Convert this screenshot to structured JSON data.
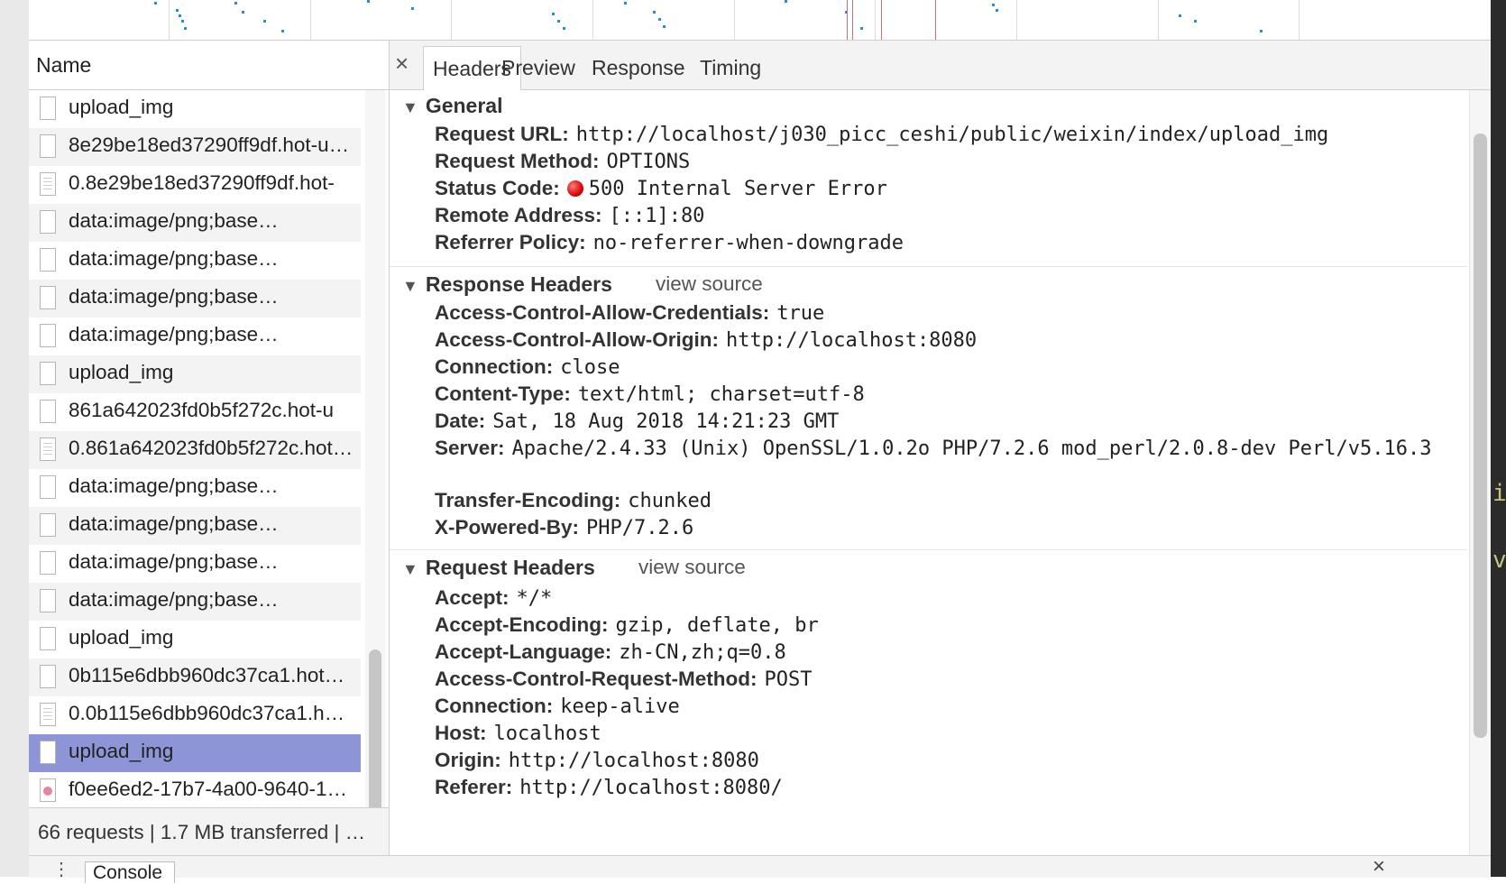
{
  "name_column": {
    "header": "Name",
    "rows": [
      {
        "name": "upload_img",
        "icon": "blank-file-icon",
        "selected": false
      },
      {
        "name": "8e29be18ed37290ff9df.hot-u…",
        "icon": "blank-file-icon",
        "selected": false
      },
      {
        "name": "0.8e29be18ed37290ff9df.hot-",
        "icon": "script-file-icon",
        "selected": false
      },
      {
        "name": "data:image/png;base…",
        "icon": "blank-file-icon",
        "selected": false
      },
      {
        "name": "data:image/png;base…",
        "icon": "blank-file-icon",
        "selected": false
      },
      {
        "name": "data:image/png;base…",
        "icon": "blank-file-icon",
        "selected": false
      },
      {
        "name": "data:image/png;base…",
        "icon": "blank-file-icon",
        "selected": false
      },
      {
        "name": "upload_img",
        "icon": "blank-file-icon",
        "selected": false
      },
      {
        "name": "861a642023fd0b5f272c.hot-u",
        "icon": "blank-file-icon",
        "selected": false
      },
      {
        "name": "0.861a642023fd0b5f272c.hot…",
        "icon": "script-file-icon",
        "selected": false
      },
      {
        "name": "data:image/png;base…",
        "icon": "blank-file-icon",
        "selected": false
      },
      {
        "name": "data:image/png;base…",
        "icon": "blank-file-icon",
        "selected": false
      },
      {
        "name": "data:image/png;base…",
        "icon": "blank-file-icon",
        "selected": false
      },
      {
        "name": "data:image/png;base…",
        "icon": "blank-file-icon",
        "selected": false
      },
      {
        "name": "upload_img",
        "icon": "blank-file-icon",
        "selected": false
      },
      {
        "name": "0b115e6dbb960dc37ca1.hot…",
        "icon": "blank-file-icon",
        "selected": false
      },
      {
        "name": "0.0b115e6dbb960dc37ca1.h…",
        "icon": "script-file-icon",
        "selected": false
      },
      {
        "name": "upload_img",
        "icon": "blank-file-icon",
        "selected": true
      },
      {
        "name": "f0ee6ed2-17b7-4a00-9640-1…",
        "icon": "image-file-icon",
        "selected": false
      }
    ],
    "status": "66 requests | 1.7 MB transferred | …"
  },
  "tabs": {
    "close": "×",
    "items": [
      "Headers",
      "Preview",
      "Response",
      "Timing"
    ],
    "active": "Headers"
  },
  "general": {
    "title": "General",
    "rows": [
      {
        "key": "Request URL:",
        "value": "http://localhost/j030_picc_ceshi/public/weixin/index/upload_img"
      },
      {
        "key": "Request Method:",
        "value": "OPTIONS"
      },
      {
        "key": "Status Code:",
        "value": "500 Internal Server Error",
        "status_color": "#d10000"
      },
      {
        "key": "Remote Address:",
        "value": "[::1]:80"
      },
      {
        "key": "Referrer Policy:",
        "value": "no-referrer-when-downgrade"
      }
    ]
  },
  "response_headers": {
    "title": "Response Headers",
    "view_source": "view source",
    "rows": [
      {
        "key": "Access-Control-Allow-Credentials:",
        "value": "true"
      },
      {
        "key": "Access-Control-Allow-Origin:",
        "value": "http://localhost:8080"
      },
      {
        "key": "Connection:",
        "value": "close"
      },
      {
        "key": "Content-Type:",
        "value": "text/html; charset=utf-8"
      },
      {
        "key": "Date:",
        "value": "Sat, 18 Aug 2018 14:21:23 GMT"
      },
      {
        "key": "Server:",
        "value": "Apache/2.4.33 (Unix) OpenSSL/1.0.2o PHP/7.2.6 mod_perl/2.0.8-dev Perl/v5.16.3"
      },
      {
        "key": "Transfer-Encoding:",
        "value": "chunked"
      },
      {
        "key": "X-Powered-By:",
        "value": "PHP/7.2.6"
      }
    ]
  },
  "request_headers": {
    "title": "Request Headers",
    "view_source": "view source",
    "rows": [
      {
        "key": "Accept:",
        "value": "*/*"
      },
      {
        "key": "Accept-Encoding:",
        "value": "gzip, deflate, br"
      },
      {
        "key": "Accept-Language:",
        "value": "zh-CN,zh;q=0.8"
      },
      {
        "key": "Access-Control-Request-Method:",
        "value": "POST"
      },
      {
        "key": "Connection:",
        "value": "keep-alive"
      },
      {
        "key": "Host:",
        "value": "localhost"
      },
      {
        "key": "Origin:",
        "value": "http://localhost:8080"
      },
      {
        "key": "Referer:",
        "value": "http://localhost:8080/"
      }
    ]
  },
  "drawer": {
    "menu": "⋮",
    "console_tab": "Console",
    "close": "×"
  },
  "right_strip": [
    "ip",
    "vo"
  ],
  "colors": {
    "selected_row": "#8d95d6",
    "waterfall_tick": "#2a8fc7",
    "waterfall_marker": "#e26a6a",
    "status_error": "#d10000"
  }
}
